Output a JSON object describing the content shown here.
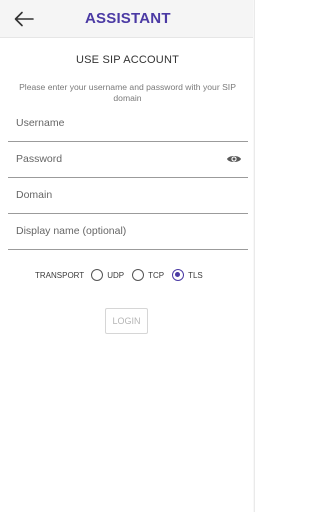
{
  "header": {
    "title": "ASSISTANT",
    "back_icon": "arrow-left-icon",
    "accent_color": "#4b3aa4"
  },
  "section_title": "USE SIP ACCOUNT",
  "info_text": "Please enter your username and password with your SIP domain",
  "fields": {
    "username": {
      "placeholder": "Username",
      "value": ""
    },
    "password": {
      "placeholder": "Password",
      "value": "",
      "toggle_icon": "eye-icon"
    },
    "domain": {
      "placeholder": "Domain",
      "value": ""
    },
    "display_name": {
      "placeholder": "Display name (optional)",
      "value": ""
    }
  },
  "transport": {
    "label": "TRANSPORT",
    "options": [
      {
        "label": "UDP",
        "selected": false
      },
      {
        "label": "TCP",
        "selected": false
      },
      {
        "label": "TLS",
        "selected": true
      }
    ]
  },
  "login_button": {
    "label": "LOGIN",
    "enabled": false
  }
}
